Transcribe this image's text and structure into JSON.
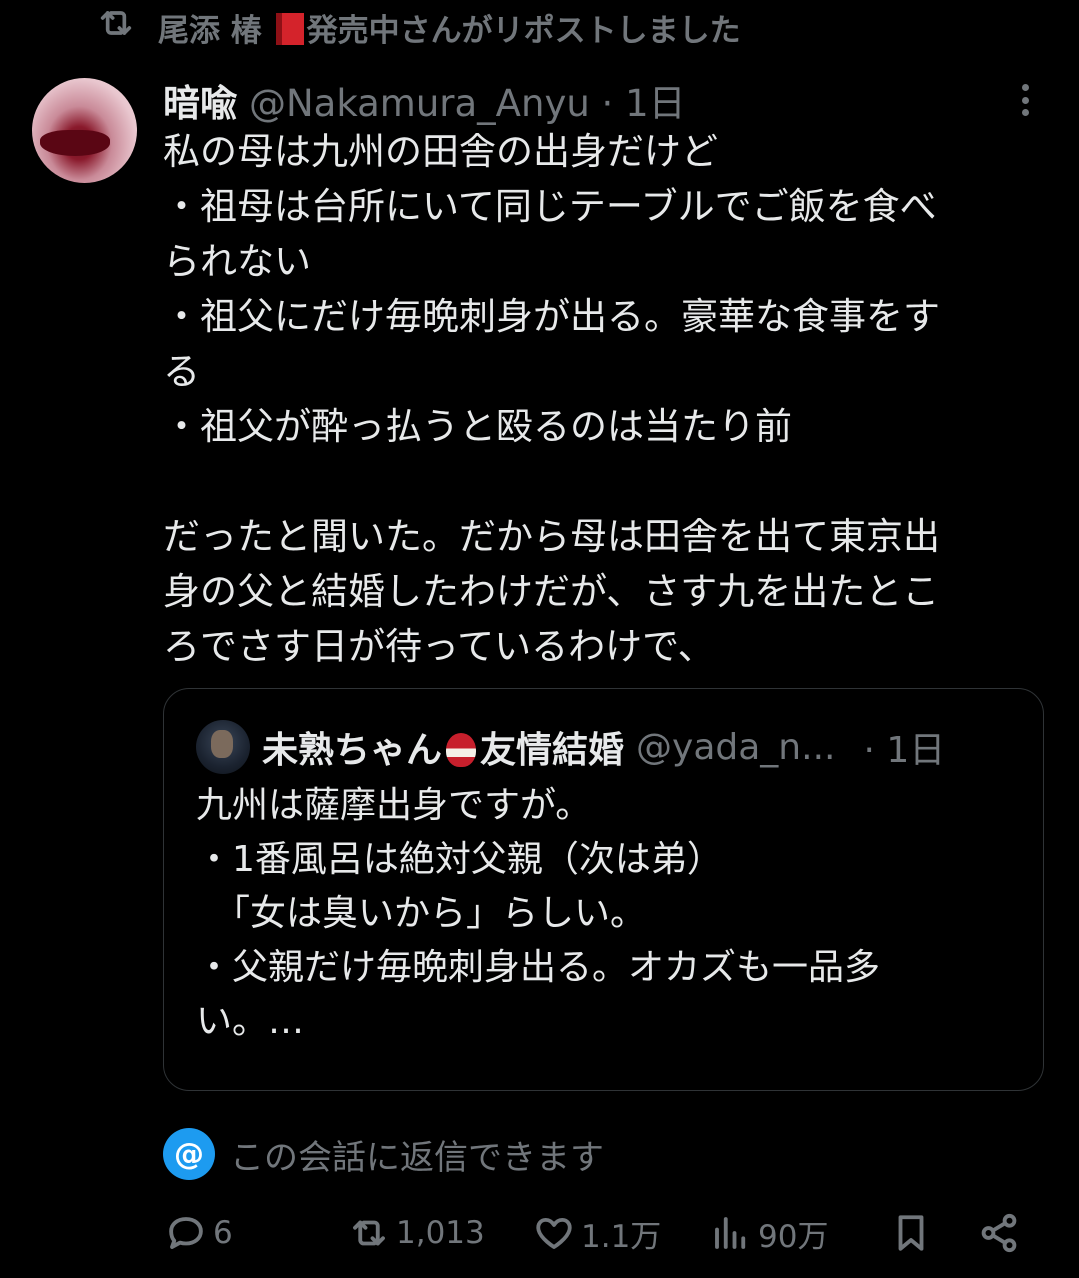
{
  "repost": {
    "name_before": "尾添 椿",
    "text_after": "発売中さんがリポストしました"
  },
  "post": {
    "name": "暗喩",
    "meta": "@Nakamura_Anyu · 1日",
    "text": "私の母は九州の田舎の出身だけど\n・祖母は台所にいて同じテーブルでご飯を食べ\nられない\n・祖父にだけ毎晩刺身が出る。豪華な食事をす\nる\n・祖父が酔っ払うと殴るのは当たり前\n\nだったと聞いた。だから母は田舎を出て東京出\n身の父と結婚したわけだが、さす九を出たとこ\nろでさす日が待っているわけで、"
  },
  "quote": {
    "name_part1": "未熟ちゃん",
    "name_part2": "友情結婚",
    "handle": "@yada_n...",
    "time": "· 1日",
    "text": "九州は薩摩出身ですが。\n・1番風呂は絶対父親（次は弟）\n　「女は臭いから」らしい。\n・父親だけ毎晩刺身出る。オカズも一品多\nい。…"
  },
  "reply_note": "この会話に返信できます",
  "actions": {
    "replies": "6",
    "reposts": "1,013",
    "likes": "1.1万",
    "views": "90万"
  },
  "colors": {
    "background": "#000000",
    "text": "#e7e9ea",
    "muted": "#71767b",
    "accent": "#1d9bf0"
  }
}
